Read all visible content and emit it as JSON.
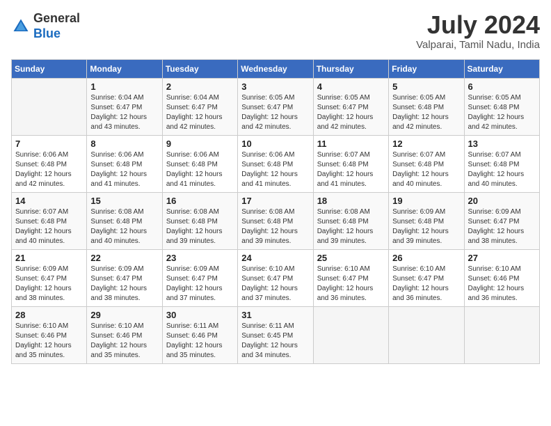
{
  "header": {
    "logo_general": "General",
    "logo_blue": "Blue",
    "month_title": "July 2024",
    "subtitle": "Valparai, Tamil Nadu, India"
  },
  "weekdays": [
    "Sunday",
    "Monday",
    "Tuesday",
    "Wednesday",
    "Thursday",
    "Friday",
    "Saturday"
  ],
  "weeks": [
    [
      {
        "day": "",
        "empty": true
      },
      {
        "day": "1",
        "sunrise": "6:04 AM",
        "sunset": "6:47 PM",
        "daylight": "12 hours and 43 minutes."
      },
      {
        "day": "2",
        "sunrise": "6:04 AM",
        "sunset": "6:47 PM",
        "daylight": "12 hours and 42 minutes."
      },
      {
        "day": "3",
        "sunrise": "6:05 AM",
        "sunset": "6:47 PM",
        "daylight": "12 hours and 42 minutes."
      },
      {
        "day": "4",
        "sunrise": "6:05 AM",
        "sunset": "6:47 PM",
        "daylight": "12 hours and 42 minutes."
      },
      {
        "day": "5",
        "sunrise": "6:05 AM",
        "sunset": "6:48 PM",
        "daylight": "12 hours and 42 minutes."
      },
      {
        "day": "6",
        "sunrise": "6:05 AM",
        "sunset": "6:48 PM",
        "daylight": "12 hours and 42 minutes."
      }
    ],
    [
      {
        "day": "7",
        "sunrise": "6:06 AM",
        "sunset": "6:48 PM",
        "daylight": "12 hours and 42 minutes."
      },
      {
        "day": "8",
        "sunrise": "6:06 AM",
        "sunset": "6:48 PM",
        "daylight": "12 hours and 41 minutes."
      },
      {
        "day": "9",
        "sunrise": "6:06 AM",
        "sunset": "6:48 PM",
        "daylight": "12 hours and 41 minutes."
      },
      {
        "day": "10",
        "sunrise": "6:06 AM",
        "sunset": "6:48 PM",
        "daylight": "12 hours and 41 minutes."
      },
      {
        "day": "11",
        "sunrise": "6:07 AM",
        "sunset": "6:48 PM",
        "daylight": "12 hours and 41 minutes."
      },
      {
        "day": "12",
        "sunrise": "6:07 AM",
        "sunset": "6:48 PM",
        "daylight": "12 hours and 40 minutes."
      },
      {
        "day": "13",
        "sunrise": "6:07 AM",
        "sunset": "6:48 PM",
        "daylight": "12 hours and 40 minutes."
      }
    ],
    [
      {
        "day": "14",
        "sunrise": "6:07 AM",
        "sunset": "6:48 PM",
        "daylight": "12 hours and 40 minutes."
      },
      {
        "day": "15",
        "sunrise": "6:08 AM",
        "sunset": "6:48 PM",
        "daylight": "12 hours and 40 minutes."
      },
      {
        "day": "16",
        "sunrise": "6:08 AM",
        "sunset": "6:48 PM",
        "daylight": "12 hours and 39 minutes."
      },
      {
        "day": "17",
        "sunrise": "6:08 AM",
        "sunset": "6:48 PM",
        "daylight": "12 hours and 39 minutes."
      },
      {
        "day": "18",
        "sunrise": "6:08 AM",
        "sunset": "6:48 PM",
        "daylight": "12 hours and 39 minutes."
      },
      {
        "day": "19",
        "sunrise": "6:09 AM",
        "sunset": "6:48 PM",
        "daylight": "12 hours and 39 minutes."
      },
      {
        "day": "20",
        "sunrise": "6:09 AM",
        "sunset": "6:47 PM",
        "daylight": "12 hours and 38 minutes."
      }
    ],
    [
      {
        "day": "21",
        "sunrise": "6:09 AM",
        "sunset": "6:47 PM",
        "daylight": "12 hours and 38 minutes."
      },
      {
        "day": "22",
        "sunrise": "6:09 AM",
        "sunset": "6:47 PM",
        "daylight": "12 hours and 38 minutes."
      },
      {
        "day": "23",
        "sunrise": "6:09 AM",
        "sunset": "6:47 PM",
        "daylight": "12 hours and 37 minutes."
      },
      {
        "day": "24",
        "sunrise": "6:10 AM",
        "sunset": "6:47 PM",
        "daylight": "12 hours and 37 minutes."
      },
      {
        "day": "25",
        "sunrise": "6:10 AM",
        "sunset": "6:47 PM",
        "daylight": "12 hours and 36 minutes."
      },
      {
        "day": "26",
        "sunrise": "6:10 AM",
        "sunset": "6:47 PM",
        "daylight": "12 hours and 36 minutes."
      },
      {
        "day": "27",
        "sunrise": "6:10 AM",
        "sunset": "6:46 PM",
        "daylight": "12 hours and 36 minutes."
      }
    ],
    [
      {
        "day": "28",
        "sunrise": "6:10 AM",
        "sunset": "6:46 PM",
        "daylight": "12 hours and 35 minutes."
      },
      {
        "day": "29",
        "sunrise": "6:10 AM",
        "sunset": "6:46 PM",
        "daylight": "12 hours and 35 minutes."
      },
      {
        "day": "30",
        "sunrise": "6:11 AM",
        "sunset": "6:46 PM",
        "daylight": "12 hours and 35 minutes."
      },
      {
        "day": "31",
        "sunrise": "6:11 AM",
        "sunset": "6:45 PM",
        "daylight": "12 hours and 34 minutes."
      },
      {
        "day": "",
        "empty": true
      },
      {
        "day": "",
        "empty": true
      },
      {
        "day": "",
        "empty": true
      }
    ]
  ]
}
